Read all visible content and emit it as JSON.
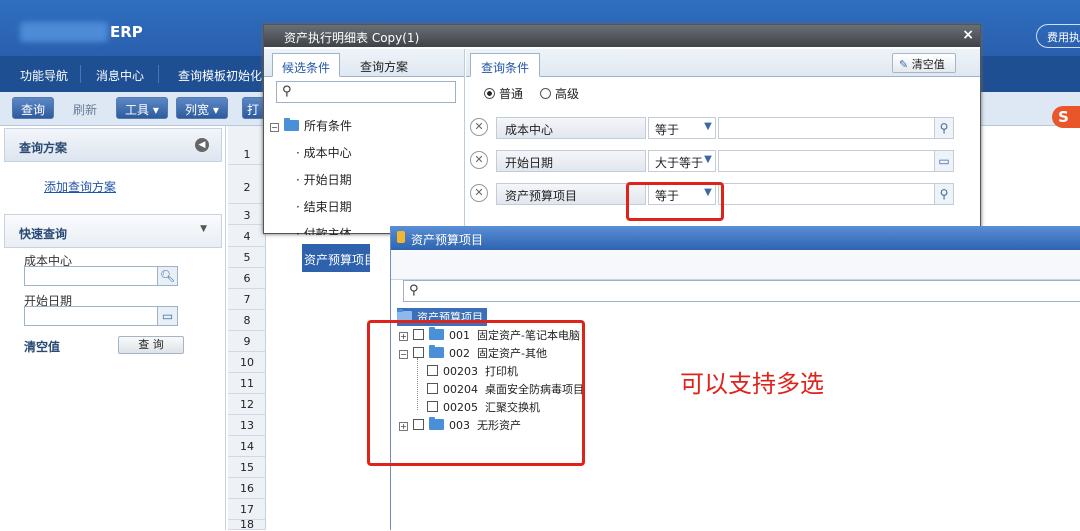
{
  "header": {
    "app_name": "ERP",
    "right_button": "费用执"
  },
  "nav": {
    "items": [
      "功能导航",
      "消息中心",
      "查询模板初始化"
    ]
  },
  "toolbar": {
    "query": "查询",
    "refresh": "刷新",
    "tools": "工具 ▾",
    "columns": "列宽 ▾",
    "partial": "打"
  },
  "left_panel": {
    "query_plan_title": "查询方案",
    "add_plan_link": "添加查询方案",
    "quick_query_title": "快速查询",
    "field1_label": "成本中心",
    "field2_label": "开始日期",
    "clear_label": "清空值",
    "query_button": "查 询"
  },
  "grid": {
    "row_numbers": [
      "1",
      "2",
      "3",
      "4",
      "5",
      "6",
      "7",
      "8",
      "9",
      "10",
      "11",
      "12",
      "13",
      "14",
      "15",
      "16",
      "17",
      "18"
    ]
  },
  "dialog1": {
    "title": "资产执行明细表 Copy(1)",
    "close": "×",
    "left_tabs": [
      "候选条件",
      "查询方案"
    ],
    "tree_root": "所有条件",
    "tree_items": [
      "成本中心",
      "开始日期",
      "结束日期",
      "付款主体",
      "资产预算项目"
    ],
    "right_tab": "查询条件",
    "clear_button": "清空值",
    "mode_normal": "普通",
    "mode_advanced": "高级",
    "conditions": [
      {
        "name": "成本中心",
        "op": "等于"
      },
      {
        "name": "开始日期",
        "op": "大于等于"
      },
      {
        "name": "资产预算项目",
        "op": "等于"
      }
    ]
  },
  "dialog2": {
    "title": "资产预算项目",
    "root": "资产预算项目",
    "nodes": [
      {
        "code": "001",
        "label": "固定资产-笔记本电脑"
      },
      {
        "code": "002",
        "label": "固定资产-其他"
      },
      {
        "code": "00203",
        "label": "打印机"
      },
      {
        "code": "00204",
        "label": "桌面安全防病毒项目"
      },
      {
        "code": "00205",
        "label": "汇聚交换机"
      },
      {
        "code": "003",
        "label": "无形资产"
      }
    ]
  },
  "annotation": "可以支持多选",
  "colors": {
    "accent": "#2a5fad",
    "annotation_red": "#e0231a"
  }
}
